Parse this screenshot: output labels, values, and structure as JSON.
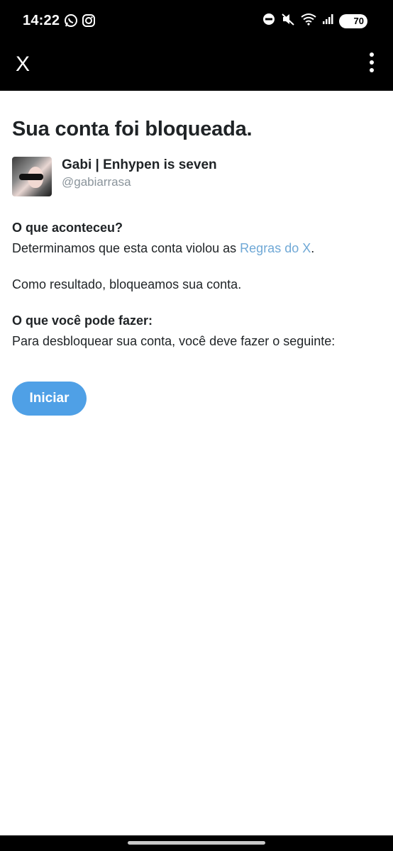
{
  "status_bar": {
    "time": "14:22",
    "battery": "70",
    "left_icons": [
      "whatsapp-icon",
      "instagram-icon"
    ],
    "right_icons": [
      "do-not-disturb-icon",
      "mute-icon",
      "wifi-icon",
      "signal-icon",
      "battery-icon"
    ]
  },
  "app_bar": {
    "logo": "X",
    "menu_icon": "more-vertical-icon"
  },
  "main": {
    "title": "Sua conta foi bloqueada.",
    "account": {
      "name": "Gabi | Enhypen is seven",
      "handle": "@gabiarrasa"
    },
    "what_happened": {
      "heading": "O que aconteceu?",
      "text": "Determinamos que esta conta violou as ",
      "link": "Regras do X",
      "suffix": "."
    },
    "result_text": "Como resultado, bloqueamos sua conta.",
    "what_to_do": {
      "heading": "O que você pode fazer:",
      "text": "Para desbloquear sua conta, você deve fazer o seguinte:"
    },
    "start_button": "Iniciar"
  },
  "colors": {
    "accent": "#4fa0e6",
    "link": "#6fa8d6",
    "text": "#1f2326",
    "muted": "#8a949b",
    "bar": "#000000"
  }
}
